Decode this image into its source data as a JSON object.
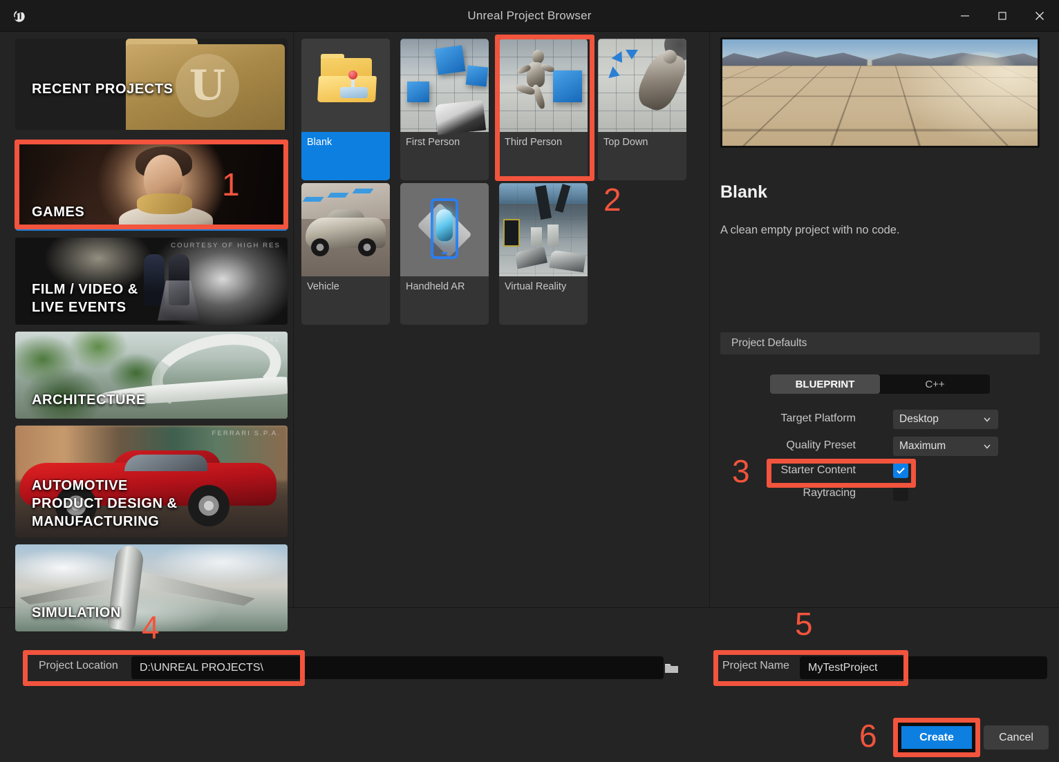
{
  "window": {
    "title": "Unreal Project Browser",
    "logo_icon": "unreal-logo-icon",
    "minimize_icon": "minimize-icon",
    "maximize_icon": "maximize-icon",
    "close_icon": "close-icon"
  },
  "categories": [
    {
      "label": "RECENT PROJECTS",
      "credit": "",
      "selected": false
    },
    {
      "label": "GAMES",
      "credit": "COURTESY OF HIGH RES",
      "selected": true
    },
    {
      "label": "FILM / VIDEO &\nLIVE EVENTS",
      "credit": "",
      "selected": false
    },
    {
      "label": "ARCHITECTURE",
      "credit": "TILTPIXEL",
      "selected": false
    },
    {
      "label": "AUTOMOTIVE\nPRODUCT DESIGN &\nMANUFACTURING",
      "credit": "FERRARI S.P.A.",
      "selected": false
    },
    {
      "label": "SIMULATION",
      "credit": "",
      "selected": false
    }
  ],
  "category_labels": {
    "recent": "RECENT PROJECTS",
    "games": "GAMES",
    "film_l1": "FILM / VIDEO &",
    "film_l2": "LIVE EVENTS",
    "arch": "ARCHITECTURE",
    "auto_l1": "AUTOMOTIVE",
    "auto_l2": "PRODUCT DESIGN &",
    "auto_l3": "MANUFACTURING",
    "sim": "SIMULATION",
    "credit_games": "COURTESY OF HIGH RES",
    "credit_arch": "TILTPIXEL",
    "credit_auto": "FERRARI S.P.A."
  },
  "templates": [
    {
      "name": "Blank",
      "selected": true
    },
    {
      "name": "First Person",
      "selected": false
    },
    {
      "name": "Third Person",
      "selected": false
    },
    {
      "name": "Top Down",
      "selected": false
    },
    {
      "name": "Vehicle",
      "selected": false
    },
    {
      "name": "Handheld AR",
      "selected": false
    },
    {
      "name": "Virtual Reality",
      "selected": false
    }
  ],
  "details": {
    "title": "Blank",
    "description": "A clean empty project with no code.",
    "preview_icon": "project-preview-image"
  },
  "project_defaults": {
    "header": "Project Defaults",
    "blueprint_label": "BLUEPRINT",
    "cpp_label": "C++",
    "selected_language": "BLUEPRINT",
    "target_platform_label": "Target Platform",
    "target_platform_value": "Desktop",
    "quality_preset_label": "Quality Preset",
    "quality_preset_value": "Maximum",
    "starter_content_label": "Starter Content",
    "starter_content_checked": true,
    "raytracing_label": "Raytracing",
    "raytracing_checked": false,
    "chevron_icon": "chevron-down-icon",
    "check_icon": "check-icon"
  },
  "footer": {
    "project_location_label": "Project Location",
    "project_location_value": "D:\\UNREAL PROJECTS\\",
    "browse_icon": "folder-icon",
    "project_name_label": "Project Name",
    "project_name_value": "MyTestProject",
    "create_label": "Create",
    "cancel_label": "Cancel"
  },
  "annotations": {
    "n1": "1",
    "n2": "2",
    "n3": "3",
    "n4": "4",
    "n5": "5",
    "n6": "6",
    "color": "#f2543d"
  },
  "colors": {
    "accent_blue": "#0c7fe0",
    "annotation_red": "#f2543d",
    "background": "#242424",
    "panel": "#1c1c1c"
  }
}
